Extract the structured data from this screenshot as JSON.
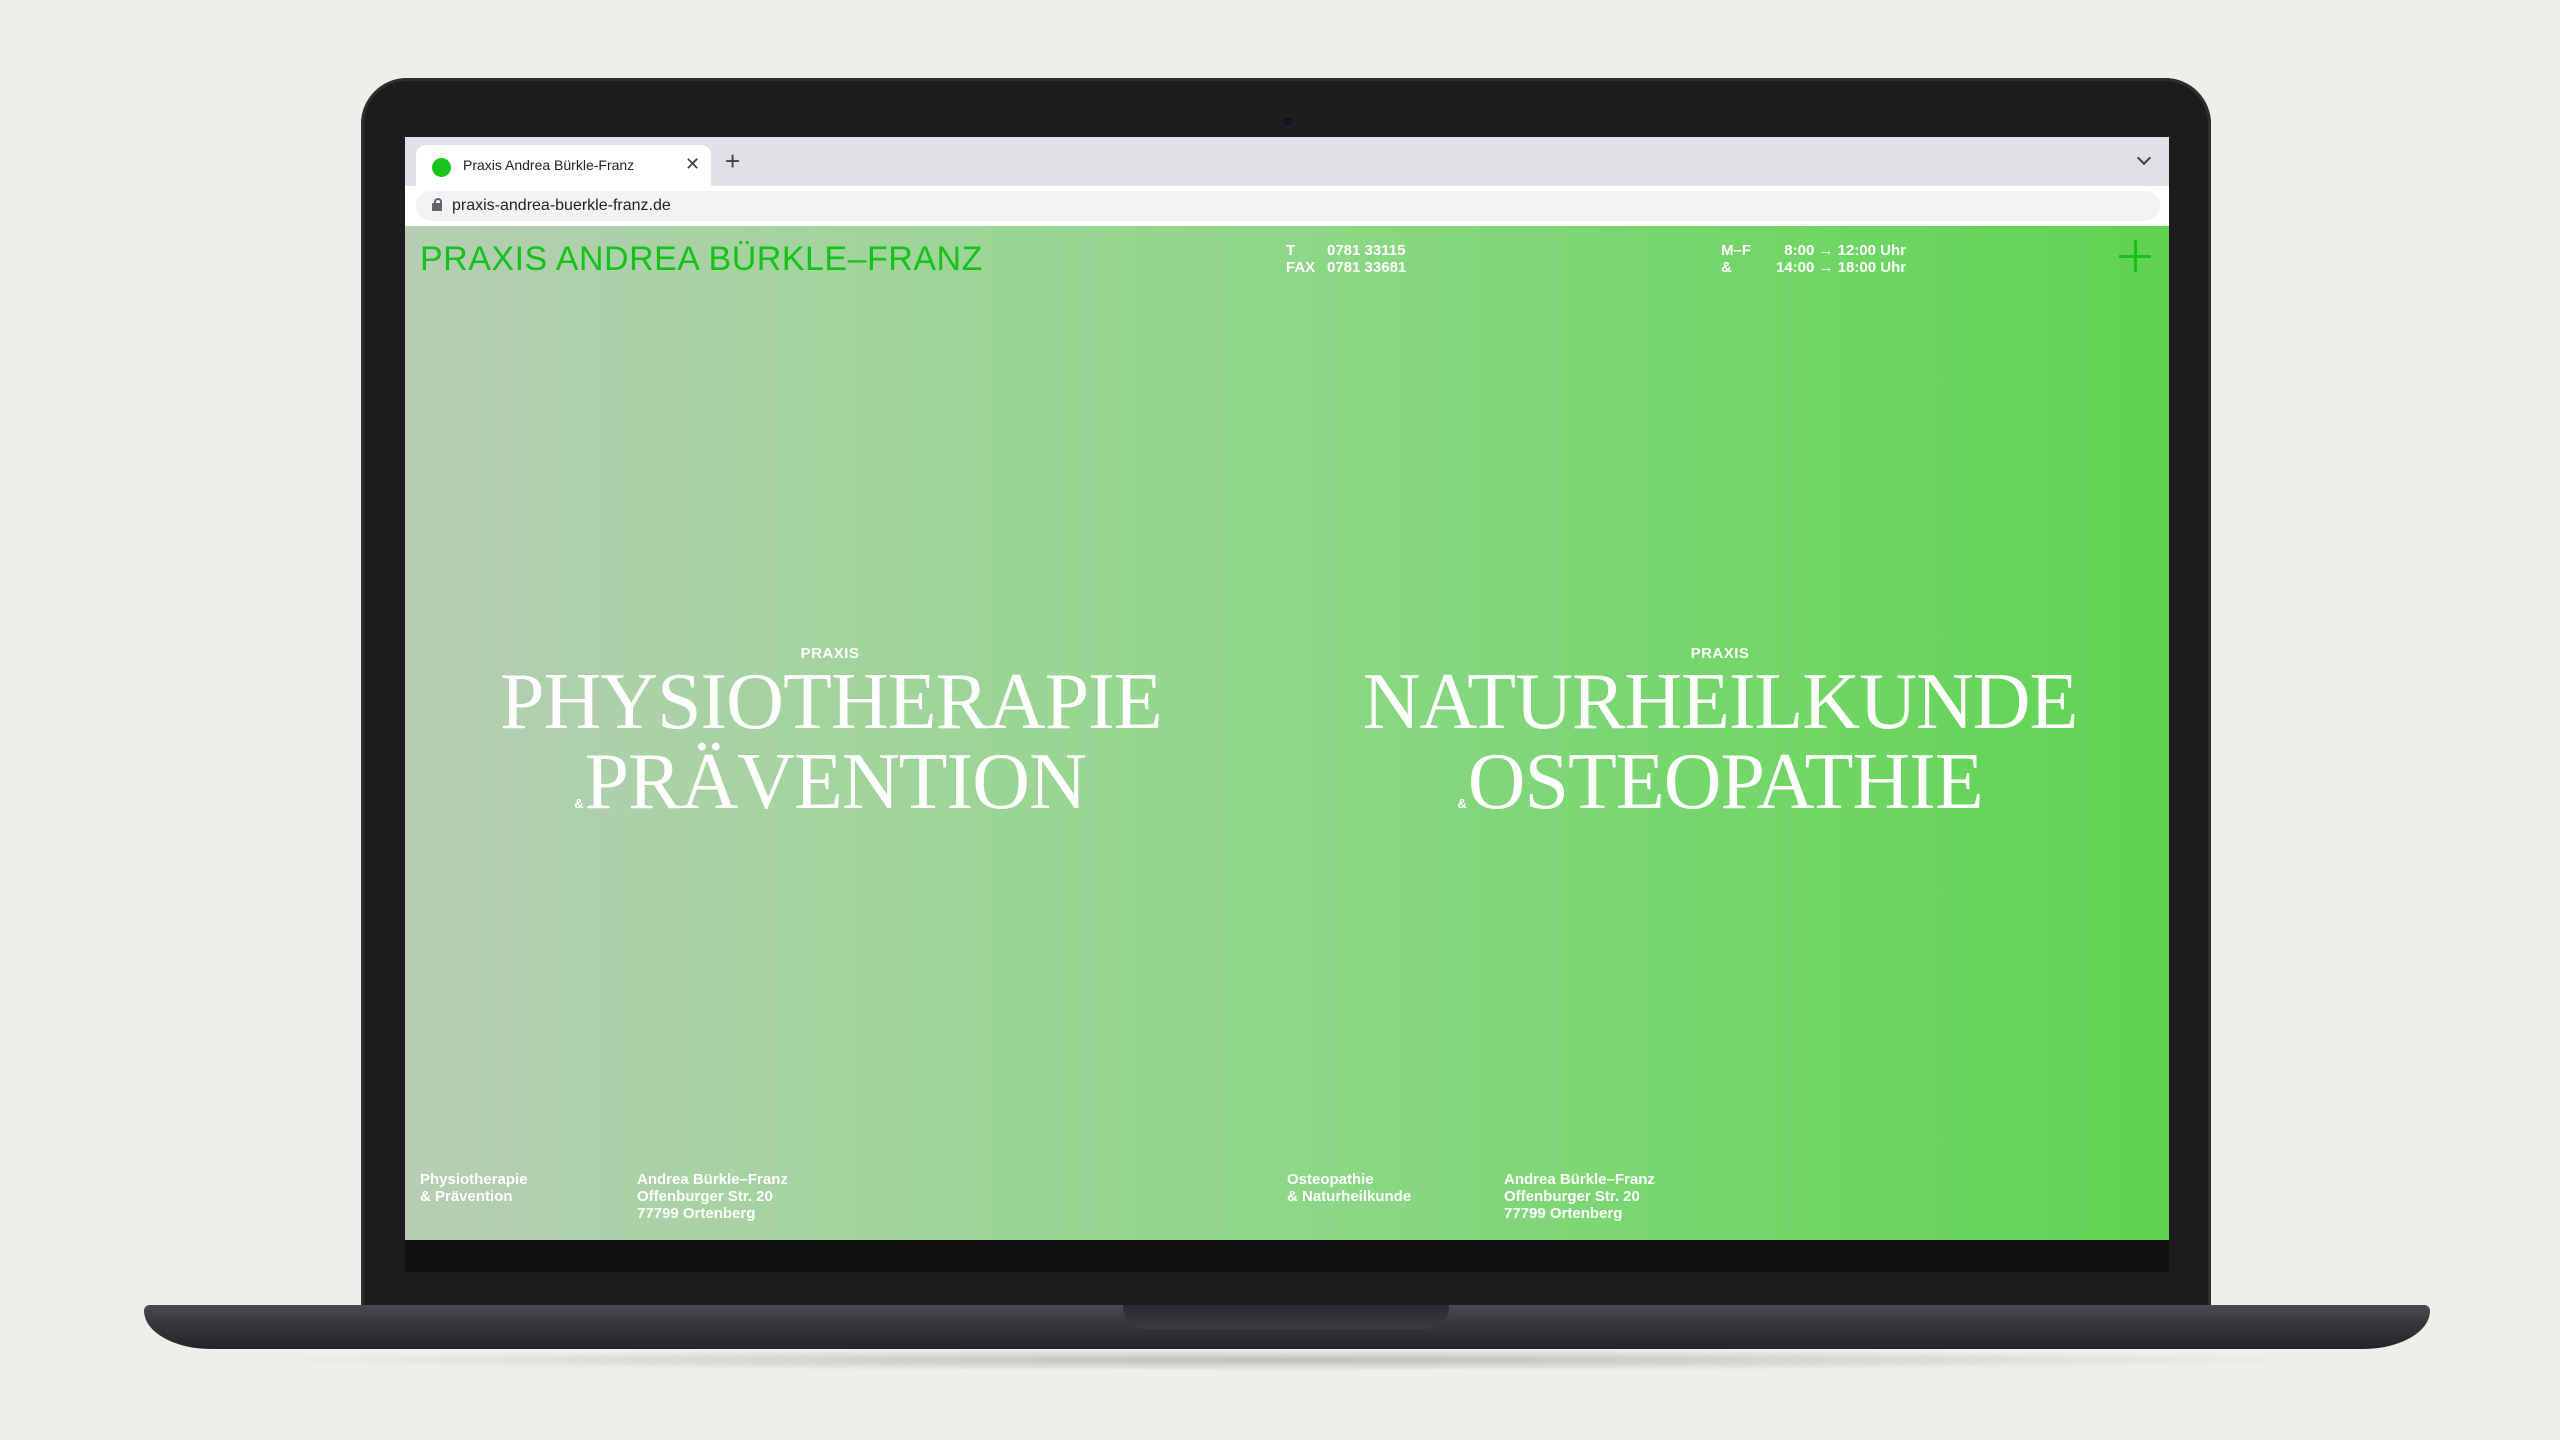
{
  "browser": {
    "tab_title": "Praxis Andrea Bürkle-Franz",
    "tab_close": "✕",
    "new_tab": "+",
    "url": "praxis-andrea-buerkle-franz.de",
    "favicon_color": "#19c51a"
  },
  "site": {
    "brand": "PRAXIS ANDREA BÜRKLE–FRANZ",
    "brand_color": "#14c21a",
    "contact": {
      "phone_label": "T",
      "phone": "0781 33115",
      "fax_label": "FAX",
      "fax": "0781 33681"
    },
    "hours": {
      "days_1": "M–F",
      "time_1": "8:00 → 12:00 Uhr",
      "days_2": "&",
      "time_2": "14:00 → 18:00 Uhr"
    },
    "menu_icon": "plus-icon",
    "left": {
      "eyebrow": "PRAXIS",
      "line1": "PHYSIOTHERAPIE",
      "amp": "&",
      "line2": "PRÄVENTION"
    },
    "right": {
      "eyebrow": "PRAXIS",
      "line1": "NATURHEILKUNDE",
      "amp": "&",
      "line2": "OSTEOPATHIE"
    },
    "footer": {
      "left_service": "Physiotherapie\n& Prävention",
      "left_address": "Andrea Bürkle–Franz\nOffenburger Str. 20\n77799 Ortenberg",
      "right_service": "Osteopathie\n& Naturheilkunde",
      "right_address": "Andrea Bürkle–Franz\nOffenburger Str. 20\n77799 Ortenberg"
    }
  }
}
